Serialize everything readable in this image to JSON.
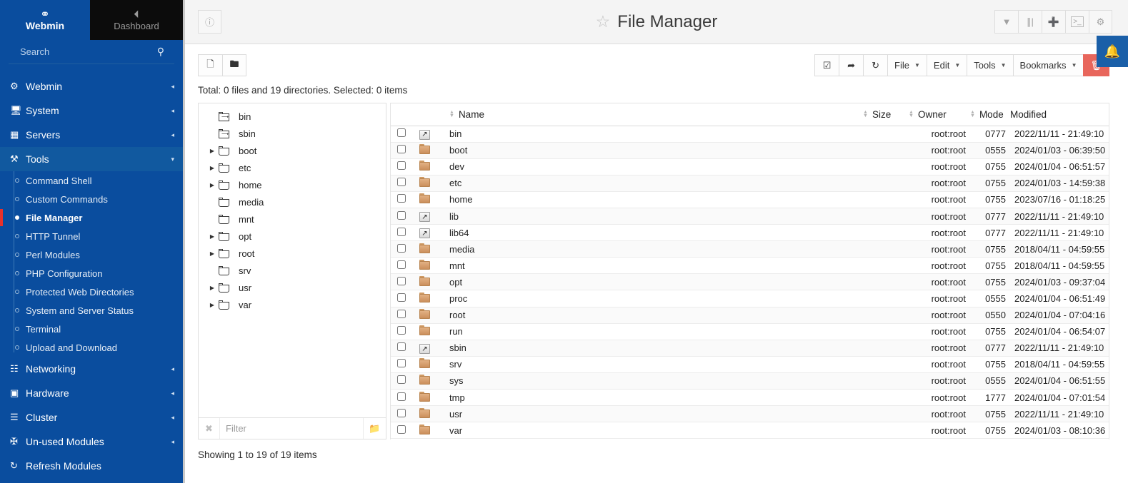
{
  "sidebar": {
    "brand": {
      "logo_icon": "webmin-logo-icon",
      "label": "Webmin"
    },
    "dashboard": {
      "icon": "dashboard-icon",
      "label": "Dashboard"
    },
    "search": {
      "placeholder": "Search",
      "value": "",
      "icon": "search-icon"
    },
    "menu": [
      {
        "label": "Webmin",
        "icon": "gear-icon",
        "caret": "◂",
        "active": false
      },
      {
        "label": "System",
        "icon": "monitor-icon",
        "caret": "◂",
        "active": false
      },
      {
        "label": "Servers",
        "icon": "server-icon",
        "caret": "◂",
        "active": false
      },
      {
        "label": "Tools",
        "icon": "tools-icon",
        "caret": "▾",
        "active": true
      }
    ],
    "tools_submenu": [
      {
        "label": "Command Shell",
        "current": false
      },
      {
        "label": "Custom Commands",
        "current": false
      },
      {
        "label": "File Manager",
        "current": true
      },
      {
        "label": "HTTP Tunnel",
        "current": false
      },
      {
        "label": "Perl Modules",
        "current": false
      },
      {
        "label": "PHP Configuration",
        "current": false
      },
      {
        "label": "Protected Web Directories",
        "current": false
      },
      {
        "label": "System and Server Status",
        "current": false
      },
      {
        "label": "Terminal",
        "current": false
      },
      {
        "label": "Upload and Download",
        "current": false
      }
    ],
    "menu_after": [
      {
        "label": "Networking",
        "icon": "network-icon",
        "caret": "◂"
      },
      {
        "label": "Hardware",
        "icon": "hardware-icon",
        "caret": "◂"
      },
      {
        "label": "Cluster",
        "icon": "layers-icon",
        "caret": "◂"
      },
      {
        "label": "Un-used Modules",
        "icon": "puzzle-icon",
        "caret": "◂"
      },
      {
        "label": "Refresh Modules",
        "icon": "refresh-icon",
        "caret": ""
      }
    ]
  },
  "header": {
    "help_icon": "help-icon",
    "star_icon": "star-icon",
    "title": "File Manager",
    "actions": [
      {
        "name": "filter-icon",
        "glyph": "▼"
      },
      {
        "name": "columns-icon",
        "glyph": "⦀"
      },
      {
        "name": "plus-icon",
        "glyph": "＋"
      },
      {
        "name": "terminal-icon",
        "glyph": "▸_"
      },
      {
        "name": "gear-icon",
        "glyph": "⚙"
      }
    ],
    "bell_icon": "bell-icon"
  },
  "toolbar": {
    "left": [
      {
        "name": "copy-folder-icon",
        "glyph": "❐"
      },
      {
        "name": "open-folder-icon",
        "glyph": "▷"
      }
    ],
    "right": [
      {
        "name": "select-all-button",
        "glyph": "☑",
        "label": "",
        "caret": false
      },
      {
        "name": "share-button",
        "glyph": "↪",
        "label": "",
        "caret": false
      },
      {
        "name": "refresh-button",
        "glyph": "↻",
        "label": "",
        "caret": false
      },
      {
        "name": "file-menu-button",
        "glyph": "",
        "label": "File",
        "caret": true
      },
      {
        "name": "edit-menu-button",
        "glyph": "",
        "label": "Edit",
        "caret": true
      },
      {
        "name": "tools-menu-button",
        "glyph": "",
        "label": "Tools",
        "caret": true
      },
      {
        "name": "bookmarks-menu-button",
        "glyph": "",
        "label": "Bookmarks",
        "caret": true
      },
      {
        "name": "delete-button",
        "glyph": "🗑",
        "label": "",
        "caret": false,
        "danger": true
      }
    ]
  },
  "totals": "Total: 0 files and 19 directories. Selected: 0 items",
  "tree": {
    "nodes": [
      {
        "label": "bin",
        "expandable": false,
        "type": "symlink"
      },
      {
        "label": "sbin",
        "expandable": false,
        "type": "symlink"
      },
      {
        "label": "boot",
        "expandable": true,
        "type": "folder"
      },
      {
        "label": "etc",
        "expandable": true,
        "type": "folder"
      },
      {
        "label": "home",
        "expandable": true,
        "type": "folder"
      },
      {
        "label": "media",
        "expandable": false,
        "type": "folder"
      },
      {
        "label": "mnt",
        "expandable": false,
        "type": "folder"
      },
      {
        "label": "opt",
        "expandable": true,
        "type": "folder"
      },
      {
        "label": "root",
        "expandable": true,
        "type": "folder"
      },
      {
        "label": "srv",
        "expandable": false,
        "type": "folder"
      },
      {
        "label": "usr",
        "expandable": true,
        "type": "folder"
      },
      {
        "label": "var",
        "expandable": true,
        "type": "folder"
      }
    ],
    "filter": {
      "placeholder": "Filter",
      "value": "",
      "clear_icon": "clear-icon",
      "folder_icon": "folder-icon"
    }
  },
  "table": {
    "columns": [
      "Name",
      "Size",
      "Owner",
      "Mode",
      "Modified"
    ],
    "rows": [
      {
        "name": "bin",
        "type": "symlink",
        "size": "",
        "owner": "root:root",
        "mode": "0777",
        "modified": "2022/11/11 - 21:49:10"
      },
      {
        "name": "boot",
        "type": "folder",
        "size": "",
        "owner": "root:root",
        "mode": "0555",
        "modified": "2024/01/03 - 06:39:50"
      },
      {
        "name": "dev",
        "type": "folder",
        "size": "",
        "owner": "root:root",
        "mode": "0755",
        "modified": "2024/01/04 - 06:51:57"
      },
      {
        "name": "etc",
        "type": "folder",
        "size": "",
        "owner": "root:root",
        "mode": "0755",
        "modified": "2024/01/03 - 14:59:38"
      },
      {
        "name": "home",
        "type": "folder",
        "size": "",
        "owner": "root:root",
        "mode": "0755",
        "modified": "2023/07/16 - 01:18:25"
      },
      {
        "name": "lib",
        "type": "symlink",
        "size": "",
        "owner": "root:root",
        "mode": "0777",
        "modified": "2022/11/11 - 21:49:10"
      },
      {
        "name": "lib64",
        "type": "symlink",
        "size": "",
        "owner": "root:root",
        "mode": "0777",
        "modified": "2022/11/11 - 21:49:10"
      },
      {
        "name": "media",
        "type": "folder",
        "size": "",
        "owner": "root:root",
        "mode": "0755",
        "modified": "2018/04/11 - 04:59:55"
      },
      {
        "name": "mnt",
        "type": "folder",
        "size": "",
        "owner": "root:root",
        "mode": "0755",
        "modified": "2018/04/11 - 04:59:55"
      },
      {
        "name": "opt",
        "type": "folder",
        "size": "",
        "owner": "root:root",
        "mode": "0755",
        "modified": "2024/01/03 - 09:37:04"
      },
      {
        "name": "proc",
        "type": "folder",
        "size": "",
        "owner": "root:root",
        "mode": "0555",
        "modified": "2024/01/04 - 06:51:49"
      },
      {
        "name": "root",
        "type": "folder",
        "size": "",
        "owner": "root:root",
        "mode": "0550",
        "modified": "2024/01/04 - 07:04:16"
      },
      {
        "name": "run",
        "type": "folder",
        "size": "",
        "owner": "root:root",
        "mode": "0755",
        "modified": "2024/01/04 - 06:54:07"
      },
      {
        "name": "sbin",
        "type": "symlink",
        "size": "",
        "owner": "root:root",
        "mode": "0777",
        "modified": "2022/11/11 - 21:49:10"
      },
      {
        "name": "srv",
        "type": "folder",
        "size": "",
        "owner": "root:root",
        "mode": "0755",
        "modified": "2018/04/11 - 04:59:55"
      },
      {
        "name": "sys",
        "type": "folder",
        "size": "",
        "owner": "root:root",
        "mode": "0555",
        "modified": "2024/01/04 - 06:51:55"
      },
      {
        "name": "tmp",
        "type": "folder",
        "size": "",
        "owner": "root:root",
        "mode": "1777",
        "modified": "2024/01/04 - 07:01:54"
      },
      {
        "name": "usr",
        "type": "folder",
        "size": "",
        "owner": "root:root",
        "mode": "0755",
        "modified": "2022/11/11 - 21:49:10"
      },
      {
        "name": "var",
        "type": "folder",
        "size": "",
        "owner": "root:root",
        "mode": "0755",
        "modified": "2024/01/03 - 08:10:36"
      }
    ]
  },
  "footer": {
    "showing": "Showing 1 to 19 of 19 items"
  },
  "colors": {
    "sidebar_blue": "#0a4d9e",
    "sidebar_active": "#11599f",
    "accent_red": "#e8312b",
    "danger": "#e8665c",
    "bell_blue": "#1a5fa8",
    "folder_orange": "#cf9a63"
  }
}
